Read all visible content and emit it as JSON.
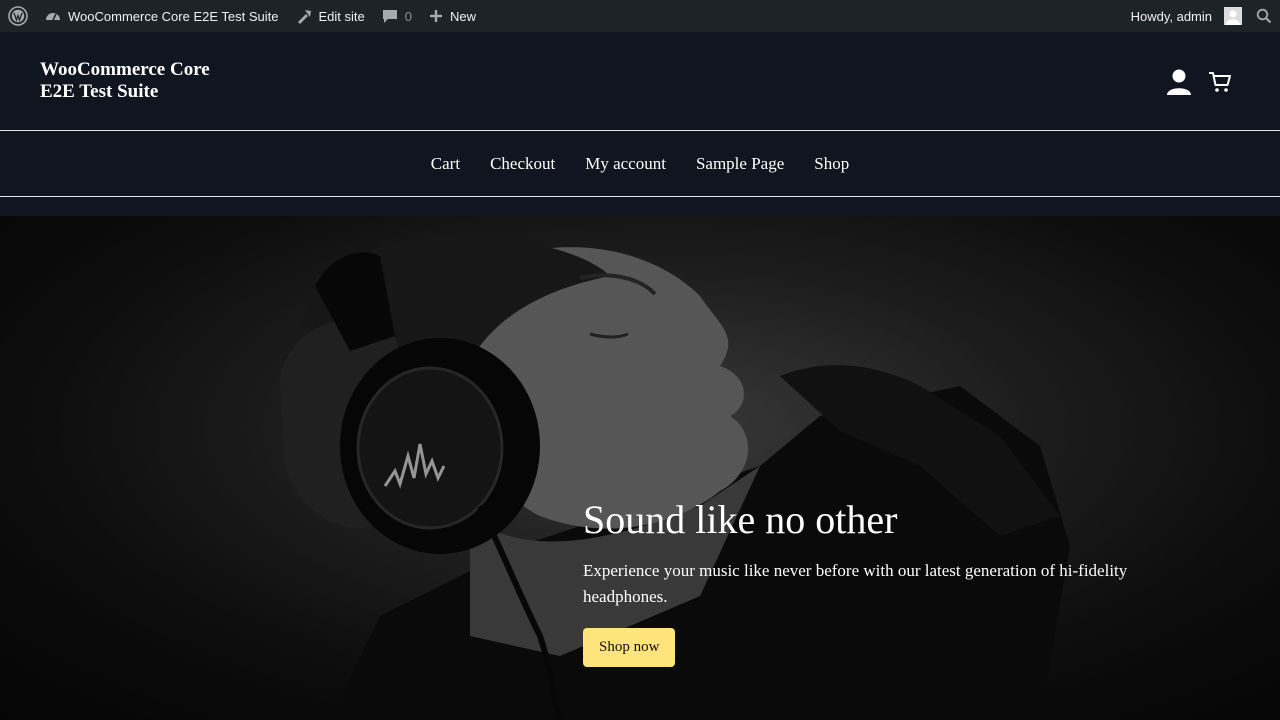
{
  "adminbar": {
    "site_name": "WooCommerce Core E2E Test Suite",
    "edit_site": "Edit site",
    "comments_count": "0",
    "new_label": "New",
    "greeting": "Howdy, admin",
    "icons": [
      "wordpress-icon",
      "dashboard-icon",
      "edit-site-icon",
      "comment-icon",
      "plus-icon",
      "search-icon"
    ]
  },
  "header": {
    "site_title": "WooCommerce Core E2E Test Suite",
    "icons": [
      "account-icon",
      "cart-icon"
    ]
  },
  "nav": {
    "items": [
      "Cart",
      "Checkout",
      "My account",
      "Sample Page",
      "Shop"
    ]
  },
  "hero": {
    "heading": "Sound like no other",
    "text": "Experience your music like never before with our latest generation of hi-fidelity headphones.",
    "button": "Shop now",
    "button_color": "#ffe37b"
  },
  "colors": {
    "adminbar_bg": "#1d2327",
    "header_bg": "#11151f"
  }
}
